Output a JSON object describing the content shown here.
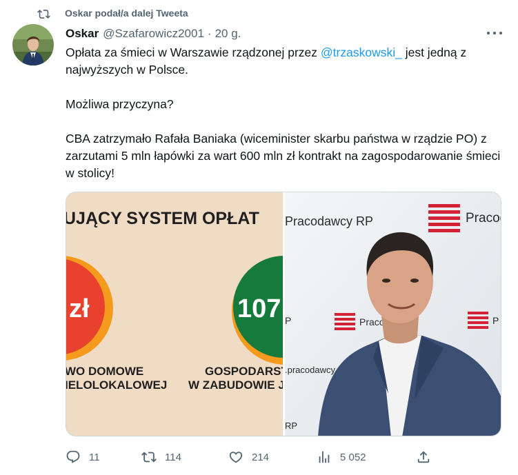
{
  "social_context": {
    "label": "Oskar podał/a dalej Tweeta"
  },
  "author": {
    "name": "Oskar",
    "handle": "@Szafarowicz2001",
    "separator": "·",
    "time": "20 g."
  },
  "tweet": {
    "line1_before": "Opłata za śmieci w Warszawie rządzonej przez ",
    "mention": "@trzaskowski_",
    "line1_after": " jest jedną z najwyższych w Polsce.",
    "para2": "Możliwa przyczyna?",
    "para3": "CBA zatrzymało Rafała Baniaka (wiceminister skarbu państwa w rządzie PO) z zarzutami 5 mln łapówki za wart 600 mln zł kontrakt na zagospodarowanie śmieci w stolicy!"
  },
  "media": {
    "left": {
      "headline": "UJĄCY SYSTEM OPŁAT",
      "circle_left_text": "zł",
      "circle_right_text": "107",
      "caption_left_1": "WO DOMOWE",
      "caption_left_2": "IELOLOKALOWEJ",
      "caption_right_1": "GOSPODARST",
      "caption_right_2": "W ZABUDOWIE J",
      "colors": {
        "background": "#f0dbc4",
        "red": "#e8412e",
        "orange": "#f49a1c",
        "green": "#157a3c"
      }
    },
    "right": {
      "banner_text": "Pracodawcy RP",
      "brand_text_top": "Pracod",
      "brand_text_mid": "Praco",
      "brand_text_right": "P",
      "website_text": ".pracodawcy",
      "rp_text": "P",
      "rp_bottom_text": "RP",
      "colors": {
        "background": "#eceff2",
        "brand_red": "#d32235",
        "suit": "#3b4f73"
      }
    }
  },
  "actions": {
    "reply": {
      "count": "11",
      "icon": "reply-icon"
    },
    "retweet": {
      "count": "114",
      "icon": "retweet-icon"
    },
    "like": {
      "count": "214",
      "icon": "heart-icon"
    },
    "views": {
      "count": "5 052",
      "icon": "analytics-icon"
    },
    "share": {
      "icon": "share-icon"
    }
  },
  "colors": {
    "accent": "#1d9bf0",
    "secondary_text": "#536471",
    "primary_text": "#0f1419"
  }
}
